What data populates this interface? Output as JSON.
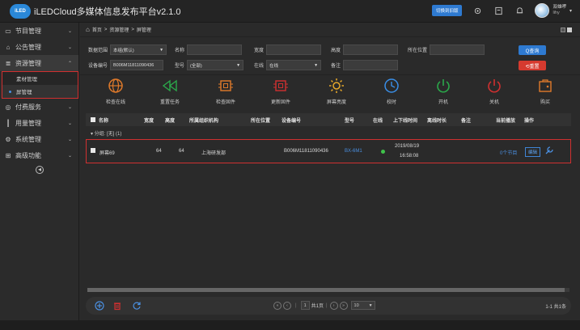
{
  "header": {
    "logo": "iLED",
    "title": "iLEDCloud多媒体信息发布平台v2.1.0",
    "switch_label": "切换到旧版",
    "user_name": "双雄啰",
    "user_handle": "lihy"
  },
  "sidebar": {
    "items": [
      {
        "label": "节目管理",
        "icon": "monitor-icon"
      },
      {
        "label": "公告管理",
        "icon": "announcement-icon"
      },
      {
        "label": "资源管理",
        "icon": "resource-icon"
      },
      {
        "label": "付费服务",
        "icon": "payment-icon"
      },
      {
        "label": "用量管理",
        "icon": "chart-icon"
      },
      {
        "label": "系统管理",
        "icon": "gear-icon"
      },
      {
        "label": "高级功能",
        "icon": "advanced-icon"
      }
    ],
    "sub_items": [
      "素材管理",
      "屏管理"
    ]
  },
  "breadcrumb": {
    "home": "首页",
    "level1": "资源管理",
    "level2": "屏管理",
    "sep": ">"
  },
  "filters": {
    "scope_label": "数据范围",
    "scope_value": "本组(默认)",
    "name_label": "名称",
    "name_value": "",
    "width_label": "宽度",
    "width_value": "",
    "height_label": "高度",
    "height_value": "",
    "location_label": "所在位置",
    "location_value": "",
    "device_label": "设备编号",
    "device_value": "B006M11811090436",
    "model_label": "型号",
    "model_value": "(全部)",
    "online_label": "在线",
    "online_value": "在线",
    "remark_label": "备注",
    "remark_value": "",
    "query_label": "Q查询",
    "reset_label": "⟲重置"
  },
  "toolbar": [
    {
      "label": "检查在线",
      "icon": "globe-icon",
      "color": "#e07a2a"
    },
    {
      "label": "重置任务",
      "icon": "rewind-icon",
      "color": "#2aa84a"
    },
    {
      "label": "检查固件",
      "icon": "chip-check-icon",
      "color": "#e07a2a"
    },
    {
      "label": "更新固件",
      "icon": "chip-update-icon",
      "color": "#d03030"
    },
    {
      "label": "屏幕亮度",
      "icon": "brightness-icon",
      "color": "#e8a92a"
    },
    {
      "label": "校时",
      "icon": "clock-icon",
      "color": "#3a8fe8"
    },
    {
      "label": "开机",
      "icon": "power-on-icon",
      "color": "#2aa84a"
    },
    {
      "label": "关机",
      "icon": "power-off-icon",
      "color": "#d03030"
    },
    {
      "label": "购买",
      "icon": "purchase-icon",
      "color": "#e07a2a"
    }
  ],
  "table": {
    "columns": [
      "名称",
      "宽度",
      "高度",
      "所属组织机构",
      "所在位置",
      "设备编号",
      "型号",
      "在线",
      "上下线时间",
      "离线时长",
      "备注",
      "当前播放",
      "操作"
    ],
    "group_label": "▾ 分组: [无] (1)",
    "rows": [
      {
        "name": "屏幕69",
        "width": "64",
        "height": "64",
        "org": "上海研发部",
        "location": "",
        "device": "B006M11811090436",
        "model": "BX-6M1",
        "time_date": "2019/08/19",
        "time_clock": "16:58:08",
        "offline": "",
        "remark": "",
        "playing": "0个节目",
        "edit_label": "编辑"
      }
    ]
  },
  "pager": {
    "page_value": "1",
    "page_total": "共1页",
    "page_size": "10",
    "info": "1-1  共1条"
  }
}
